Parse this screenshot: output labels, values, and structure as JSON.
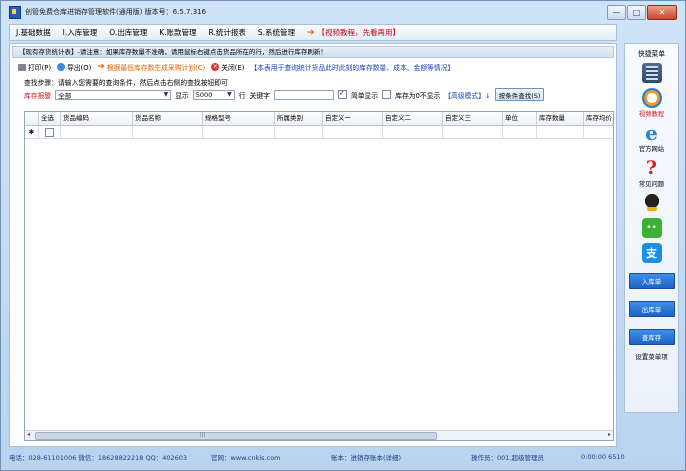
{
  "window": {
    "title": "创管免费仓库进销存管理软件(通用版) 版本号：6.5.7.316",
    "controls": [
      "—",
      "□",
      "✕"
    ]
  },
  "menu": {
    "items": [
      "J.基础数据",
      "I.入库管理",
      "O.出库管理",
      "K.账款管理",
      "R.统计报表",
      "S.系统管理"
    ],
    "video_label": "【视频教程，先看再用】"
  },
  "main": {
    "info_text": "【现有存货统计表】-请注意：如果库存数量不准确，请用鼠标右键点击货品所在的行，然后进行库存刷新！",
    "toolbar": {
      "print": "打印(P)",
      "export": "导出(O)",
      "purchase_plan": "根据最低库存数生成采购计划(C)",
      "close": "关闭(E)",
      "note": "【本表用于查询统计货品此时此刻的库存数量、成本、金额等情况】"
    },
    "steps": "查找步骤：请输入您需要的查询条件，然后点击右侧的查找按钮即可",
    "filter": {
      "warehouse_label": "库存报警",
      "warehouse_value": "全部",
      "display_label": "显示",
      "display_value": "5000",
      "rows_label": "行",
      "keyword_label": "关键字",
      "keyword_value": "",
      "simple_display": "简单显示",
      "zero_stock": "库存为0不显示",
      "advanced": "【高级模式】↓",
      "search_button": "按条件查找(S)"
    },
    "grid": {
      "columns": [
        "",
        "全选",
        "货品编码",
        "货品名称",
        "规格型号",
        "所属类别",
        "自定义一",
        "自定义二",
        "自定义三",
        "单位",
        "库存数量",
        "库存均价"
      ],
      "row_marker": "✱"
    }
  },
  "side": {
    "title": "快捷菜单",
    "items": [
      {
        "label": "",
        "icon": "calculator-icon"
      },
      {
        "label": "视频教程",
        "icon": "video-icon"
      },
      {
        "label": "官方网站",
        "icon": "ie-icon"
      },
      {
        "label": "常见问题",
        "icon": "question-icon"
      },
      {
        "label": "",
        "icon": "qq-icon"
      },
      {
        "label": "",
        "icon": "wechat-icon"
      },
      {
        "label": "",
        "icon": "alipay-icon"
      }
    ],
    "buttons": [
      "入库单",
      "出库单",
      "查库存"
    ],
    "settings": "设置菜单项"
  },
  "status": {
    "phone": "电话：028-61101006 微信：18628822218 QQ：402603",
    "website": "官网：www.cnkis.com",
    "account": "账本：进销存账本(详细)",
    "operator": "操作员：001,超级管理员",
    "extra": "0:00:00 6510"
  }
}
